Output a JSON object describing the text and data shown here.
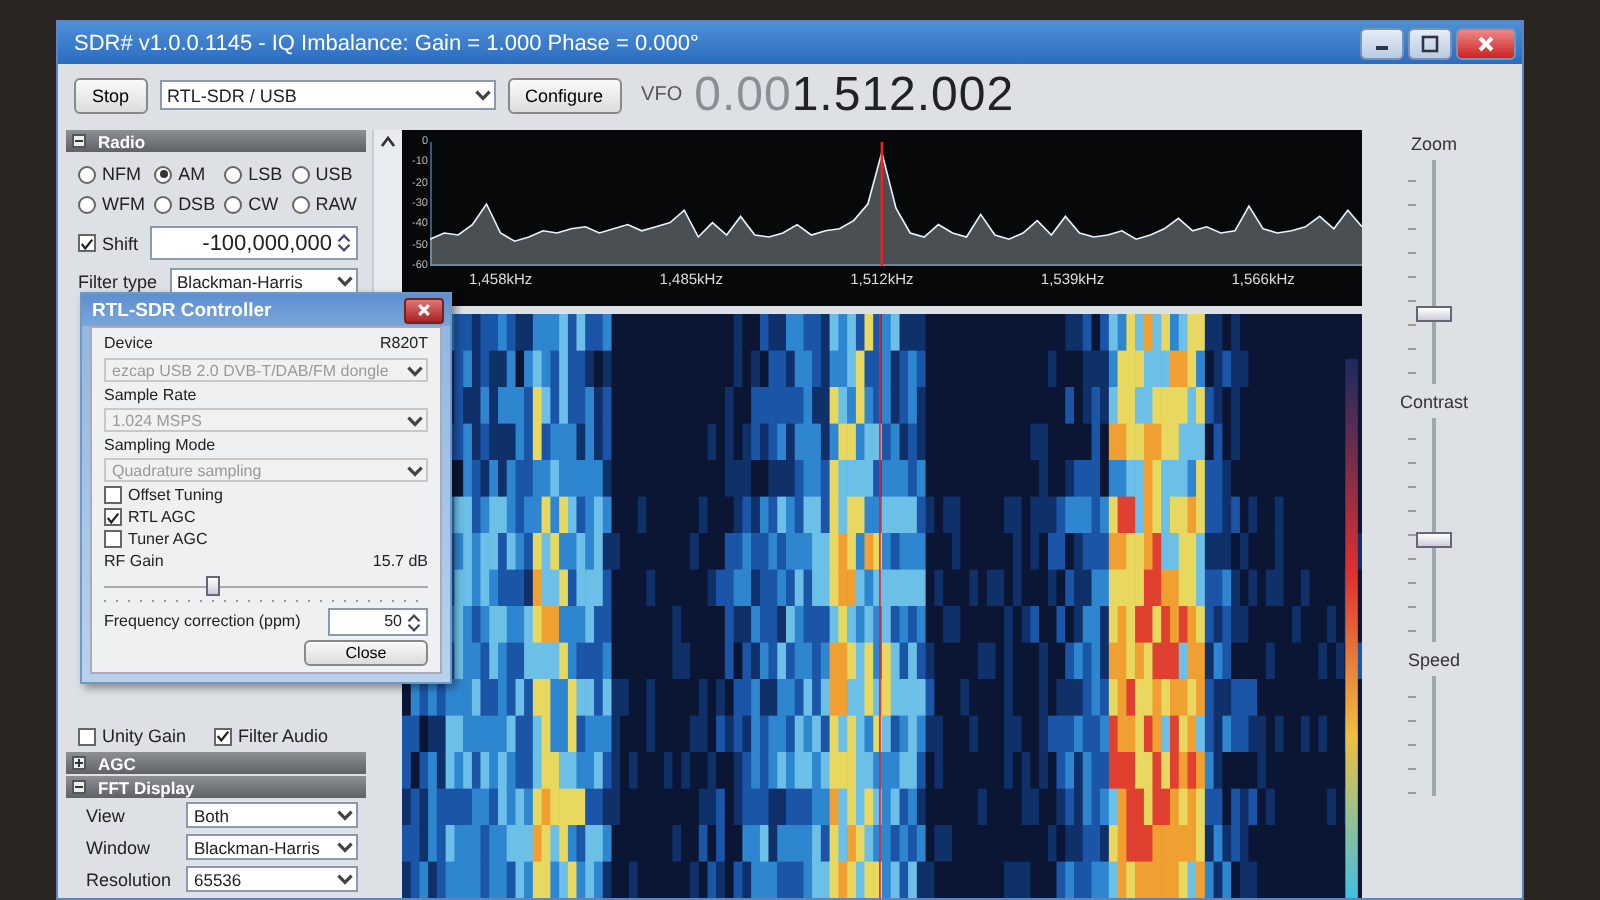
{
  "window": {
    "title": "SDR# v1.0.0.1145 - IQ Imbalance: Gain = 1.000 Phase = 0.000°"
  },
  "toolbar": {
    "stop_button": "Stop",
    "source": "RTL-SDR / USB",
    "configure_button": "Configure",
    "vfo_label": "VFO",
    "vfo_leading": "0.00",
    "vfo_value": "1.512.002"
  },
  "radio_panel": {
    "title": "Radio",
    "expanded": true,
    "modes": [
      {
        "label": "NFM",
        "selected": false
      },
      {
        "label": "AM",
        "selected": true
      },
      {
        "label": "LSB",
        "selected": false
      },
      {
        "label": "USB",
        "selected": false
      },
      {
        "label": "WFM",
        "selected": false
      },
      {
        "label": "DSB",
        "selected": false
      },
      {
        "label": "CW",
        "selected": false
      },
      {
        "label": "RAW",
        "selected": false
      }
    ],
    "shift": {
      "label": "Shift",
      "checked": true,
      "value": "-100,000,000"
    },
    "filter_type": {
      "label": "Filter type",
      "value": "Blackman-Harris"
    }
  },
  "audio_options": [
    {
      "label": "Unity Gain",
      "checked": false
    },
    {
      "label": "Filter Audio",
      "checked": true
    }
  ],
  "sections": [
    {
      "title": "AGC",
      "expanded": false
    },
    {
      "title": "FFT Display",
      "expanded": true
    }
  ],
  "fft_display": [
    {
      "label": "View",
      "value": "Both"
    },
    {
      "label": "Window",
      "value": "Blackman-Harris"
    },
    {
      "label": "Resolution",
      "value": "65536"
    }
  ],
  "spectrum": {
    "chart_data": {
      "type": "area",
      "xlim": [
        1448,
        1580
      ],
      "ylim": [
        -60,
        0
      ],
      "x": [
        1448,
        1450,
        1452,
        1454,
        1456,
        1458,
        1460,
        1462,
        1464,
        1466,
        1468,
        1470,
        1472,
        1474,
        1476,
        1478,
        1480,
        1482,
        1484,
        1486,
        1488,
        1490,
        1492,
        1494,
        1496,
        1498,
        1500,
        1502,
        1504,
        1506,
        1508,
        1510,
        1512,
        1514,
        1516,
        1518,
        1520,
        1522,
        1524,
        1526,
        1528,
        1530,
        1532,
        1534,
        1536,
        1538,
        1540,
        1542,
        1544,
        1546,
        1548,
        1550,
        1552,
        1554,
        1556,
        1558,
        1560,
        1562,
        1564,
        1566,
        1568,
        1570,
        1572,
        1574,
        1576,
        1578,
        1580
      ],
      "series": [
        {
          "color": "#e8f4ff",
          "values": [
            -47,
            -44,
            -45,
            -40,
            -30,
            -44,
            -48,
            -46,
            -43,
            -44,
            -42,
            -41,
            -44,
            -42,
            -40,
            -43,
            -41,
            -39,
            -33,
            -46,
            -39,
            -45,
            -36,
            -45,
            -46,
            -44,
            -40,
            -45,
            -43,
            -42,
            -38,
            -30,
            -5,
            -32,
            -44,
            -46,
            -40,
            -44,
            -46,
            -35,
            -45,
            -47,
            -44,
            -38,
            -45,
            -36,
            -44,
            -46,
            -45,
            -43,
            -47,
            -45,
            -42,
            -37,
            -43,
            -41,
            -44,
            -43,
            -31,
            -42,
            -44,
            -43,
            -41,
            -36,
            -42,
            -33,
            -41
          ]
        }
      ],
      "xticks": [
        {
          "value": 1458,
          "label": "1,458kHz"
        },
        {
          "value": 1485,
          "label": "1,485kHz"
        },
        {
          "value": 1512,
          "label": "1,512kHz"
        },
        {
          "value": 1539,
          "label": "1,539kHz"
        },
        {
          "value": 1566,
          "label": "1,566kHz"
        }
      ],
      "yticks": [
        0,
        -10,
        -20,
        -30,
        -40,
        -50,
        -60
      ],
      "ref_lines": [
        {
          "axis": "x",
          "value": 1512,
          "color": "#ee2222"
        }
      ]
    }
  },
  "sliders": [
    {
      "label": "Zoom",
      "level": 0.3
    },
    {
      "label": "Contrast",
      "level": 0.45
    },
    {
      "label": "Speed"
    }
  ],
  "dialog": {
    "title": "RTL-SDR Controller",
    "device_label": "Device",
    "tuner": "R820T",
    "device": {
      "value": "ezcap USB 2.0 DVB-T/DAB/FM dongle",
      "disabled": true
    },
    "sample_rate_label": "Sample Rate",
    "sample_rate": {
      "value": "1.024 MSPS",
      "disabled": true
    },
    "sampling_mode_label": "Sampling Mode",
    "sampling_mode": {
      "value": "Quadrature sampling",
      "disabled": true
    },
    "options": [
      {
        "label": "Offset Tuning",
        "checked": false
      },
      {
        "label": "RTL AGC",
        "checked": true
      },
      {
        "label": "Tuner AGC",
        "checked": false
      }
    ],
    "rf_gain_label": "RF Gain",
    "rf_gain_value": "15.7 dB",
    "rf_gain": {
      "level": 0.33
    },
    "freq_correction_label": "Frequency correction (ppm)",
    "freq_correction": "50",
    "close_button": "Close"
  }
}
